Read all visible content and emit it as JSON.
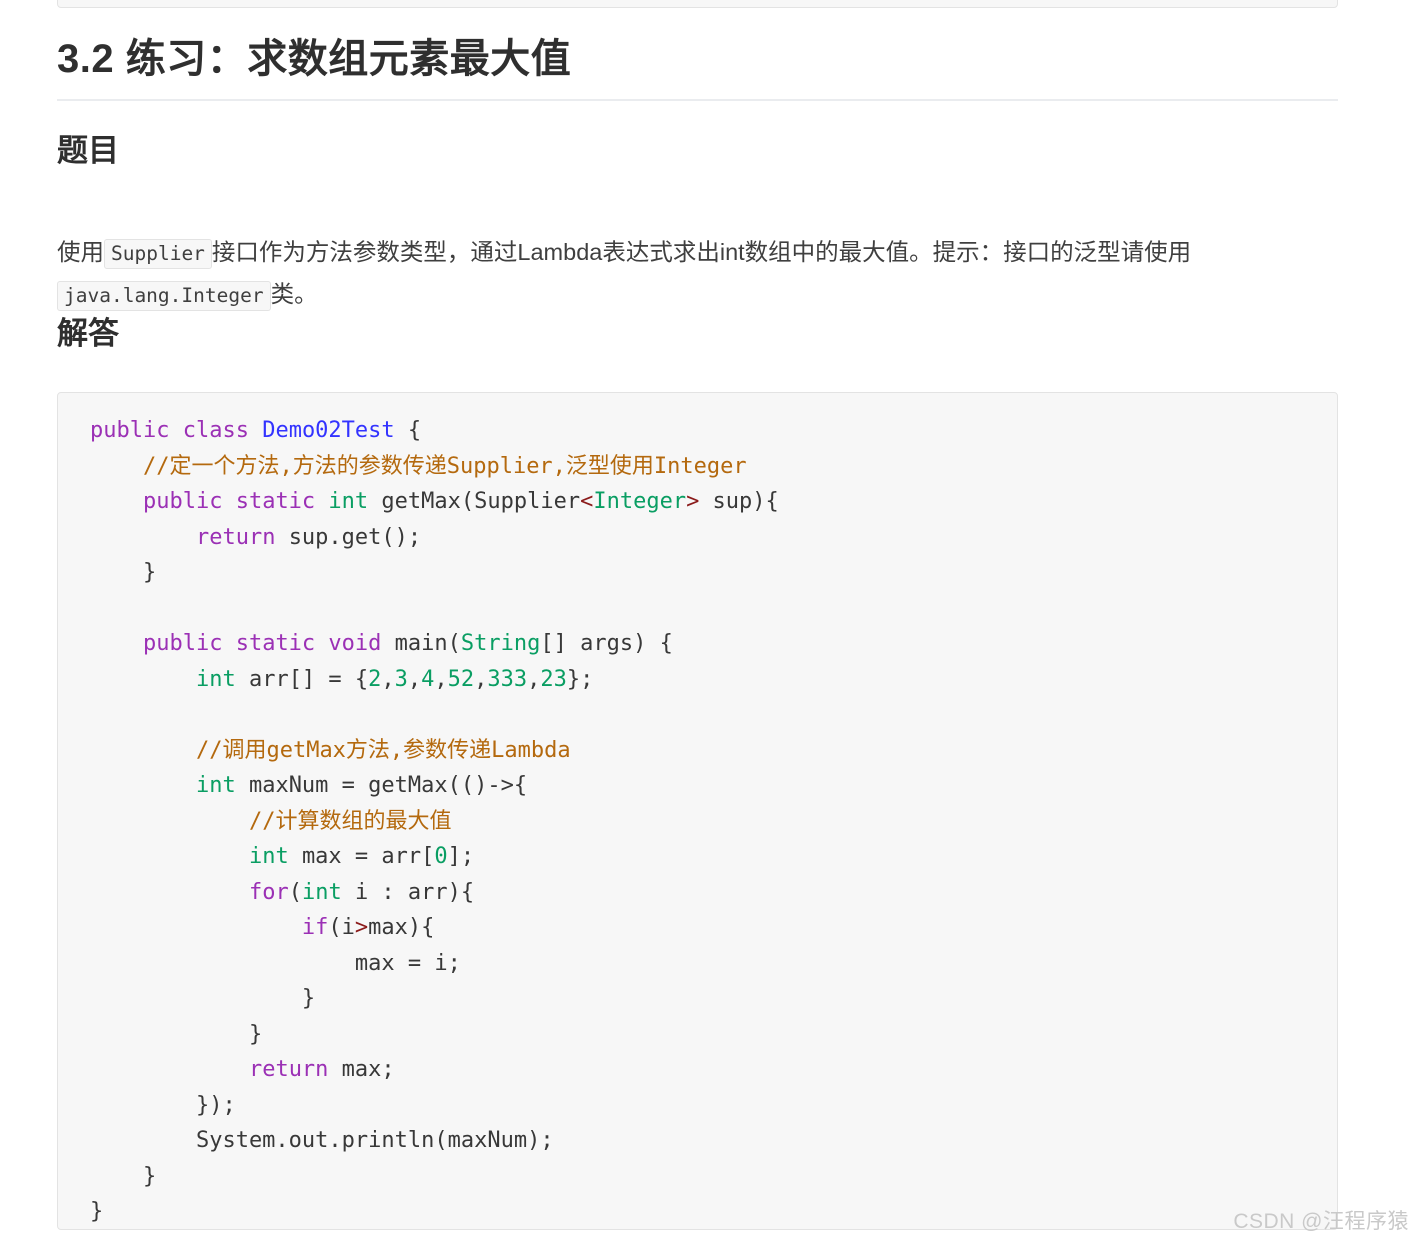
{
  "page": {
    "heading_1": "3.2 练习：求数组元素最大值",
    "section_question_heading": "题目",
    "section_answer_heading": "解答",
    "watermark": "CSDN @汪程序猿"
  },
  "question": {
    "text_part_1": "使用",
    "inline_code_1": "Supplier",
    "text_part_2": "接口作为方法参数类型，通过Lambda表达式求出int数组中的最大值。提示：接口的泛型请使用",
    "inline_code_2": "java.lang.Integer",
    "text_part_3": "类。"
  },
  "code": {
    "language": "java",
    "lines": [
      [
        {
          "t": "public ",
          "c": "kw"
        },
        {
          "t": "class ",
          "c": "kw"
        },
        {
          "t": "Demo02Test",
          "c": "cls"
        },
        {
          "t": " {",
          "c": "pl"
        }
      ],
      [
        {
          "t": "    ",
          "c": "pl"
        },
        {
          "t": "//定一个方法,方法的参数传递Supplier,泛型使用Integer",
          "c": "cmt"
        }
      ],
      [
        {
          "t": "    ",
          "c": "pl"
        },
        {
          "t": "public ",
          "c": "kw"
        },
        {
          "t": "static ",
          "c": "kw"
        },
        {
          "t": "int ",
          "c": "type"
        },
        {
          "t": "getMax(Supplier",
          "c": "pl"
        },
        {
          "t": "<",
          "c": "op"
        },
        {
          "t": "Integer",
          "c": "type"
        },
        {
          "t": ">",
          "c": "op"
        },
        {
          "t": " sup){",
          "c": "pl"
        }
      ],
      [
        {
          "t": "        ",
          "c": "pl"
        },
        {
          "t": "return ",
          "c": "kw"
        },
        {
          "t": "sup.get();",
          "c": "pl"
        }
      ],
      [
        {
          "t": "    }",
          "c": "pl"
        }
      ],
      [
        {
          "t": "",
          "c": "pl"
        }
      ],
      [
        {
          "t": "    ",
          "c": "pl"
        },
        {
          "t": "public ",
          "c": "kw"
        },
        {
          "t": "static ",
          "c": "kw"
        },
        {
          "t": "void ",
          "c": "kw"
        },
        {
          "t": "main(",
          "c": "pl"
        },
        {
          "t": "String",
          "c": "type"
        },
        {
          "t": "[] args) {",
          "c": "pl"
        }
      ],
      [
        {
          "t": "        ",
          "c": "pl"
        },
        {
          "t": "int ",
          "c": "type"
        },
        {
          "t": "arr[] = {",
          "c": "pl"
        },
        {
          "t": "2",
          "c": "num"
        },
        {
          "t": ",",
          "c": "pl"
        },
        {
          "t": "3",
          "c": "num"
        },
        {
          "t": ",",
          "c": "pl"
        },
        {
          "t": "4",
          "c": "num"
        },
        {
          "t": ",",
          "c": "pl"
        },
        {
          "t": "52",
          "c": "num"
        },
        {
          "t": ",",
          "c": "pl"
        },
        {
          "t": "333",
          "c": "num"
        },
        {
          "t": ",",
          "c": "pl"
        },
        {
          "t": "23",
          "c": "num"
        },
        {
          "t": "};",
          "c": "pl"
        }
      ],
      [
        {
          "t": "",
          "c": "pl"
        }
      ],
      [
        {
          "t": "        ",
          "c": "pl"
        },
        {
          "t": "//调用getMax方法,参数传递Lambda",
          "c": "cmt"
        }
      ],
      [
        {
          "t": "        ",
          "c": "pl"
        },
        {
          "t": "int ",
          "c": "type"
        },
        {
          "t": "maxNum = getMax(()->{",
          "c": "pl"
        }
      ],
      [
        {
          "t": "            ",
          "c": "pl"
        },
        {
          "t": "//计算数组的最大值",
          "c": "cmt"
        }
      ],
      [
        {
          "t": "            ",
          "c": "pl"
        },
        {
          "t": "int ",
          "c": "type"
        },
        {
          "t": "max = arr[",
          "c": "pl"
        },
        {
          "t": "0",
          "c": "num"
        },
        {
          "t": "];",
          "c": "pl"
        }
      ],
      [
        {
          "t": "            ",
          "c": "pl"
        },
        {
          "t": "for",
          "c": "kw"
        },
        {
          "t": "(",
          "c": "pl"
        },
        {
          "t": "int ",
          "c": "type"
        },
        {
          "t": "i : arr){",
          "c": "pl"
        }
      ],
      [
        {
          "t": "                ",
          "c": "pl"
        },
        {
          "t": "if",
          "c": "kw"
        },
        {
          "t": "(i",
          "c": "pl"
        },
        {
          "t": ">",
          "c": "op"
        },
        {
          "t": "max){",
          "c": "pl"
        }
      ],
      [
        {
          "t": "                    max = i;",
          "c": "pl"
        }
      ],
      [
        {
          "t": "                }",
          "c": "pl"
        }
      ],
      [
        {
          "t": "            }",
          "c": "pl"
        }
      ],
      [
        {
          "t": "            ",
          "c": "pl"
        },
        {
          "t": "return ",
          "c": "kw"
        },
        {
          "t": "max;",
          "c": "pl"
        }
      ],
      [
        {
          "t": "        });",
          "c": "pl"
        }
      ],
      [
        {
          "t": "        System.out.println(maxNum);",
          "c": "pl"
        }
      ],
      [
        {
          "t": "    }",
          "c": "pl"
        }
      ],
      [
        {
          "t": "}",
          "c": "pl"
        }
      ]
    ]
  },
  "colors": {
    "keyword": "#9b30b5",
    "class_name": "#3333ff",
    "type": "#0a9e63",
    "number": "#0a9e63",
    "comment": "#b4690e",
    "operator": "#8b1a1a",
    "plain": "#383838",
    "code_background": "#f7f7f7",
    "code_border": "#e3e3e3",
    "heading": "#2f2f2f",
    "rule": "#eaecef",
    "watermark": "#c9c9c9"
  }
}
